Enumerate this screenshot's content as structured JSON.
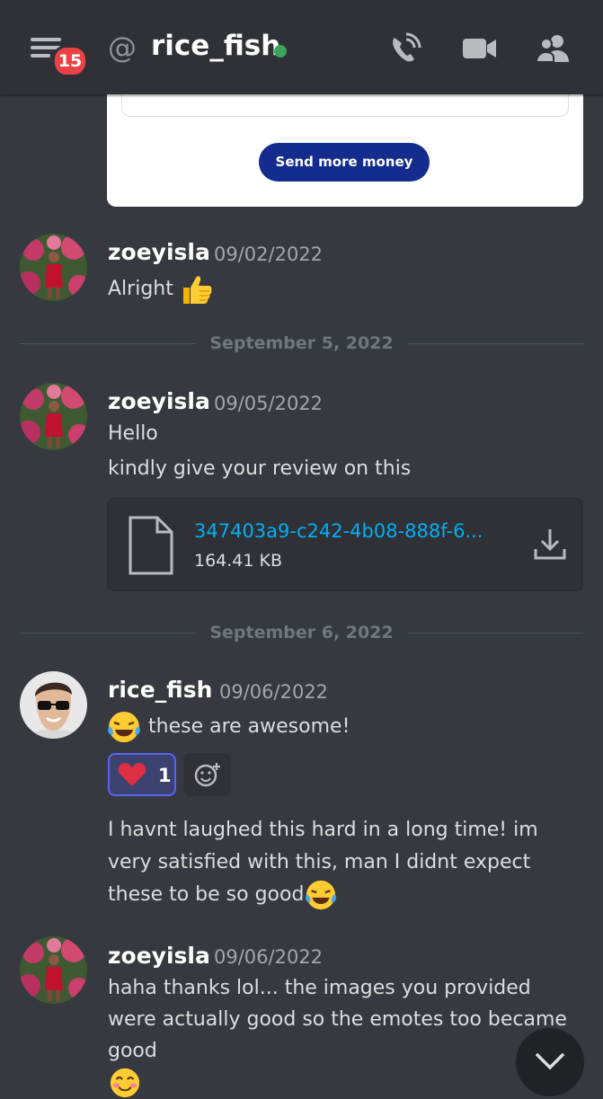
{
  "header": {
    "badge_count": "15",
    "at_symbol": "@",
    "channel_name": "rice_fish",
    "status_color": "#3ba55d",
    "icons": [
      "menu-icon",
      "phone-call-icon",
      "video-call-icon",
      "members-icon"
    ]
  },
  "payment_card": {
    "button_label": "Send more money",
    "button_color": "#142c8e"
  },
  "dividers": [
    {
      "label": "September 5, 2022"
    },
    {
      "label": "September 6, 2022"
    }
  ],
  "messages": [
    {
      "author": "zoeyisla",
      "timestamp": "09/02/2022",
      "lines": [
        "Alright"
      ],
      "emoji": "thumbs-up-icon"
    },
    {
      "author": "zoeyisla",
      "timestamp": "09/05/2022",
      "lines": [
        "Hello",
        "kindly give your review on this"
      ],
      "attachment": {
        "file_name": "347403a9-c242-4b08-888f-6...",
        "file_size": "164.41 KB"
      }
    },
    {
      "author": "rice_fish",
      "timestamp": "09/06/2022",
      "lines": [
        "these are awesome!"
      ],
      "reaction": {
        "emoji": "heart-icon",
        "count": "1"
      },
      "followup": "I havnt laughed this hard in a long time! im very satisfied with this, man I didnt expect these to be so good"
    },
    {
      "author": "zoeyisla",
      "timestamp": "09/06/2022",
      "text": "haha thanks lol... the images you provided were actually good so the emotes too became good"
    }
  ],
  "colors": {
    "background": "#36393f",
    "header": "#2f3136",
    "link": "#00aff4",
    "mention_badge": "#ed4245"
  }
}
